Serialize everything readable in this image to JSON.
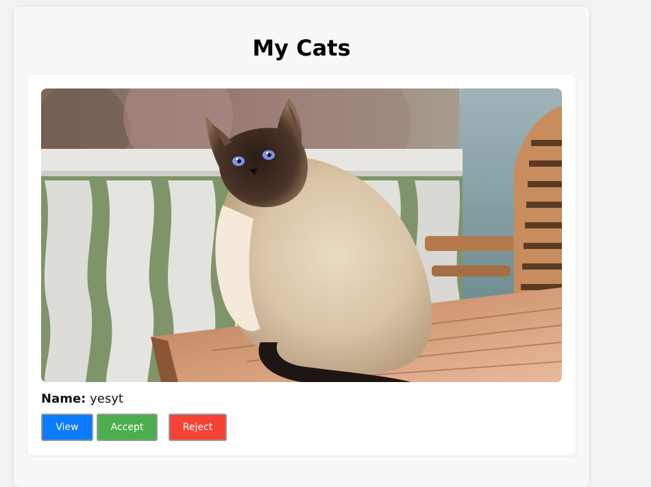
{
  "page": {
    "title": "My Cats"
  },
  "cat": {
    "name_label": "Name:",
    "name_value": "yesyt",
    "photo_alt": "cat-photo"
  },
  "actions": {
    "view_label": "View",
    "accept_label": "Accept",
    "reject_label": "Reject"
  },
  "colors": {
    "view": "#0a7bff",
    "accept": "#4cae4f",
    "reject": "#f44336"
  }
}
